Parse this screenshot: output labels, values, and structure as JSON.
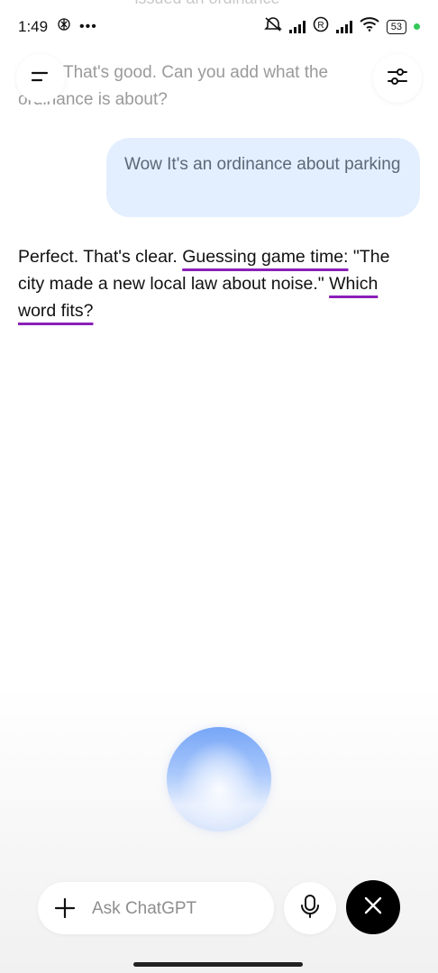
{
  "status_bar": {
    "time": "1:49",
    "battery": "53",
    "icons": [
      "chatgpt-icon",
      "more-icon",
      "mute-icon",
      "signal-icon",
      "roaming-icon",
      "signal-icon",
      "wifi-icon",
      "battery-icon"
    ]
  },
  "header": {
    "menu_icon": "menu-icon",
    "settings_icon": "sliders-icon"
  },
  "conversation": {
    "faded_top_text": "issued an ordinance",
    "faded_message": "That's good. Can you add what the ordinance is about?",
    "user_message": "Wow It's an ordinance about parking",
    "assistant": {
      "part1": "Perfect. That's clear. ",
      "highlight1": "Guessing game time:",
      "part2": " \"The city made a new local law about noise.\" ",
      "highlight2": "Which word fits?"
    },
    "highlight_color": "#8a1fb8"
  },
  "composer": {
    "placeholder": "Ask ChatGPT",
    "plus_icon": "plus-icon",
    "mic_icon": "microphone-icon",
    "close_icon": "close-icon"
  }
}
